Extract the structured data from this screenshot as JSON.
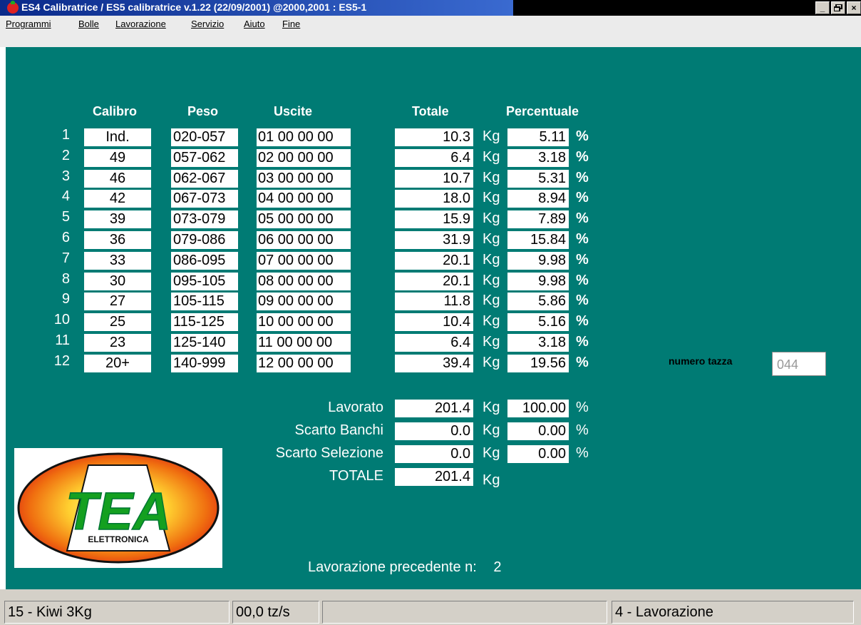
{
  "window": {
    "title": "ES4 Calibratrice / ES5 calibratrice  v.1.22 (22/09/2001) @2000,2001 : ES5-1",
    "buttons": [
      "_",
      " ",
      "×"
    ]
  },
  "menu": [
    "Programmi",
    "Bolle",
    "Lavorazione",
    "Servizio",
    "Aiuto",
    "Fine"
  ],
  "headers": {
    "calibro": "Calibro",
    "peso": "Peso",
    "uscite": "Uscite",
    "totale": "Totale",
    "percentuale": "Percentuale"
  },
  "rows": [
    {
      "n": "1",
      "calibro": "Ind.",
      "peso": "020-057",
      "uscite": "01 00 00 00",
      "totale": "10.3",
      "unit": "Kg",
      "perc": "5.11",
      "pct": "%"
    },
    {
      "n": "2",
      "calibro": "49",
      "peso": "057-062",
      "uscite": "02 00 00 00",
      "totale": "6.4",
      "unit": "Kg",
      "perc": "3.18",
      "pct": "%"
    },
    {
      "n": "3",
      "calibro": "46",
      "peso": "062-067",
      "uscite": "03 00 00 00",
      "totale": "10.7",
      "unit": "Kg",
      "perc": "5.31",
      "pct": "%"
    },
    {
      "n": "4",
      "calibro": "42",
      "peso": "067-073",
      "uscite": "04 00 00 00",
      "totale": "18.0",
      "unit": "Kg",
      "perc": "8.94",
      "pct": "%"
    },
    {
      "n": "5",
      "calibro": "39",
      "peso": "073-079",
      "uscite": "05 00 00 00",
      "totale": "15.9",
      "unit": "Kg",
      "perc": "7.89",
      "pct": "%"
    },
    {
      "n": "6",
      "calibro": "36",
      "peso": "079-086",
      "uscite": "06 00 00 00",
      "totale": "31.9",
      "unit": "Kg",
      "perc": "15.84",
      "pct": "%"
    },
    {
      "n": "7",
      "calibro": "33",
      "peso": "086-095",
      "uscite": "07 00 00 00",
      "totale": "20.1",
      "unit": "Kg",
      "perc": "9.98",
      "pct": "%"
    },
    {
      "n": "8",
      "calibro": "30",
      "peso": "095-105",
      "uscite": "08 00 00 00",
      "totale": "20.1",
      "unit": "Kg",
      "perc": "9.98",
      "pct": "%"
    },
    {
      "n": "9",
      "calibro": "27",
      "peso": "105-115",
      "uscite": "09 00 00 00",
      "totale": "11.8",
      "unit": "Kg",
      "perc": "5.86",
      "pct": "%"
    },
    {
      "n": "10",
      "calibro": "25",
      "peso": "115-125",
      "uscite": "10 00 00 00",
      "totale": "10.4",
      "unit": "Kg",
      "perc": "5.16",
      "pct": "%"
    },
    {
      "n": "11",
      "calibro": "23",
      "peso": "125-140",
      "uscite": "11 00 00 00",
      "totale": "6.4",
      "unit": "Kg",
      "perc": "3.18",
      "pct": "%"
    },
    {
      "n": "12",
      "calibro": "20+",
      "peso": "140-999",
      "uscite": "12 00 00 00",
      "totale": "39.4",
      "unit": "Kg",
      "perc": "19.56",
      "pct": "%"
    }
  ],
  "summary": [
    {
      "label": "Lavorato",
      "totale": "201.4",
      "unit": "Kg",
      "perc": "100.00",
      "pct": "%"
    },
    {
      "label": "Scarto Banchi",
      "totale": "0.0",
      "unit": "Kg",
      "perc": "0.00",
      "pct": "%"
    },
    {
      "label": "Scarto Selezione",
      "totale": "0.0",
      "unit": "Kg",
      "perc": "0.00",
      "pct": "%"
    },
    {
      "label": "TOTALE",
      "totale": "201.4",
      "unit": "Kg"
    }
  ],
  "precedente": {
    "label": "Lavorazione precedente n:",
    "value": "2"
  },
  "tazza": {
    "label": "numero tazza",
    "value": "044"
  },
  "logo": {
    "text": "TEA",
    "subtext": "ELETTRONICA"
  },
  "status": [
    "15 - Kiwi 3Kg",
    "00,0 tz/s",
    "",
    "4 - Lavorazione"
  ]
}
